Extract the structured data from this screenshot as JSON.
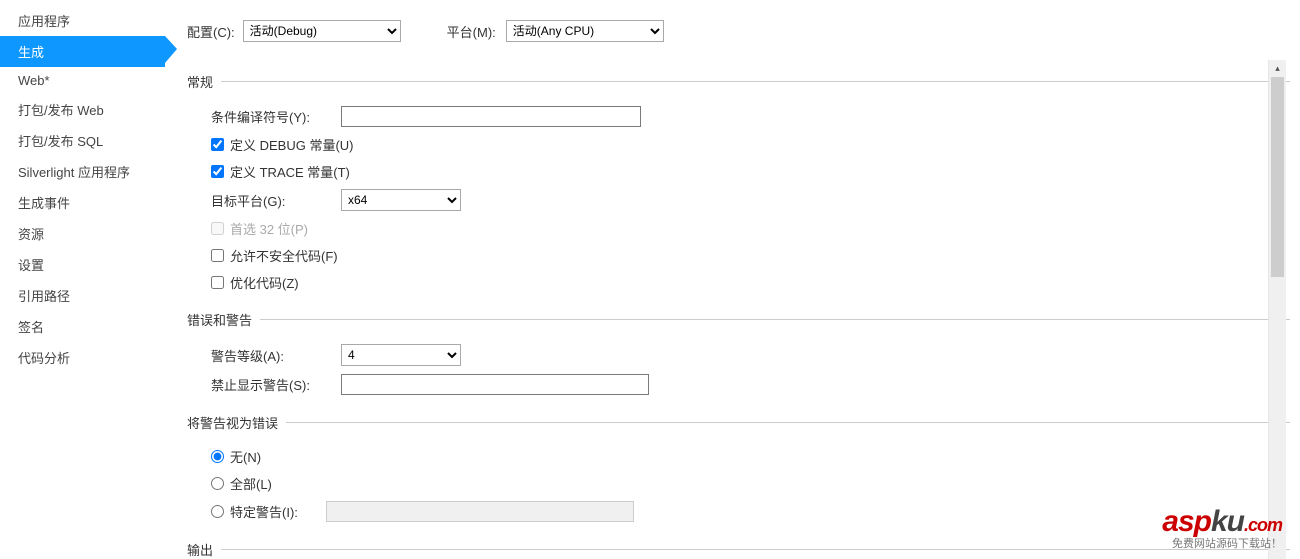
{
  "sidebar": {
    "items": [
      {
        "label": "应用程序",
        "active": false
      },
      {
        "label": "生成",
        "active": true
      },
      {
        "label": "Web*",
        "active": false
      },
      {
        "label": "打包/发布 Web",
        "active": false
      },
      {
        "label": "打包/发布 SQL",
        "active": false
      },
      {
        "label": "Silverlight 应用程序",
        "active": false
      },
      {
        "label": "生成事件",
        "active": false
      },
      {
        "label": "资源",
        "active": false
      },
      {
        "label": "设置",
        "active": false
      },
      {
        "label": "引用路径",
        "active": false
      },
      {
        "label": "签名",
        "active": false
      },
      {
        "label": "代码分析",
        "active": false
      }
    ]
  },
  "top": {
    "config_label": "配置(C):",
    "config_value": "活动(Debug)",
    "platform_label": "平台(M):",
    "platform_value": "活动(Any CPU)"
  },
  "sections": {
    "general": {
      "title": "常规",
      "cond_compile_label": "条件编译符号(Y):",
      "cond_compile_value": "",
      "define_debug": "定义 DEBUG 常量(U)",
      "define_trace": "定义 TRACE 常量(T)",
      "target_platform_label": "目标平台(G):",
      "target_platform_value": "x64",
      "prefer_32bit": "首选 32 位(P)",
      "allow_unsafe": "允许不安全代码(F)",
      "optimize": "优化代码(Z)"
    },
    "errors": {
      "title": "错误和警告",
      "warn_level_label": "警告等级(A):",
      "warn_level_value": "4",
      "suppress_label": "禁止显示警告(S):",
      "suppress_value": ""
    },
    "treat_as_errors": {
      "title": "将警告视为错误",
      "none": "无(N)",
      "all": "全部(L)",
      "specific": "特定警告(I):",
      "specific_value": ""
    },
    "output": {
      "title": "输出"
    }
  },
  "watermark": {
    "main_asp": "asp",
    "main_ku": "ku",
    "main_com": ".com",
    "sub": "免费网站源码下载站！"
  }
}
